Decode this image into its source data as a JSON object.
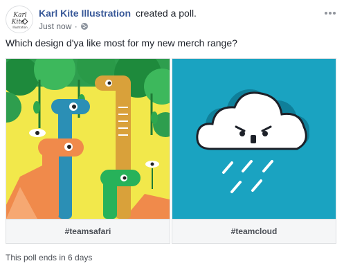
{
  "post": {
    "page_name": "Karl Kite Illustration",
    "action": "created a poll.",
    "timestamp": "Just now",
    "separator": "·",
    "audience_icon": "globe-icon",
    "more_icon": "more-options-icon",
    "text": "Which design d'ya like most for my new merch range?"
  },
  "avatar": {
    "logo_text_line1": "Karl",
    "logo_text_line2": "Kite",
    "logo_text_line3": "Illustration"
  },
  "poll": {
    "options": [
      {
        "label": "#teamsafari",
        "image": "safari-illustration"
      },
      {
        "label": "#teamcloud",
        "image": "angry-cloud-illustration"
      }
    ],
    "ends_text": "This poll ends in 6 days"
  },
  "colors": {
    "link": "#385898",
    "cloud_background": "#1aa3c1",
    "safari_background": "#f2e84b"
  }
}
